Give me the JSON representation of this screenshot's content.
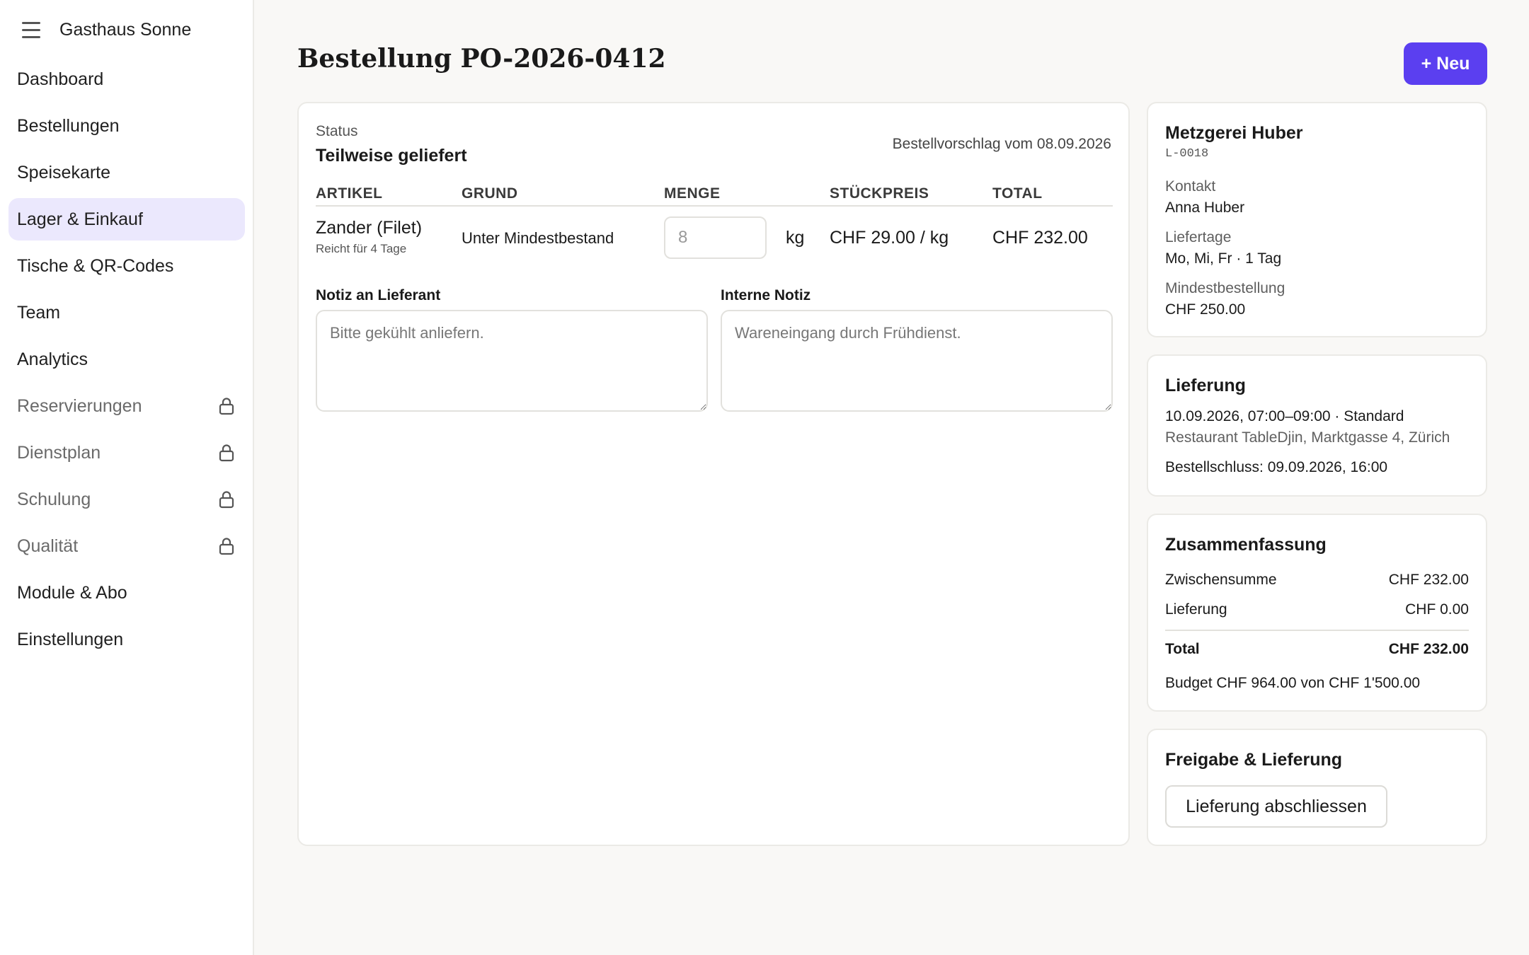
{
  "app": {
    "name": "Gasthaus Sonne"
  },
  "sidebar": {
    "items": [
      {
        "label": "Dashboard"
      },
      {
        "label": "Bestellungen"
      },
      {
        "label": "Speisekarte"
      },
      {
        "label": "Lager & Einkauf"
      },
      {
        "label": "Tische & QR-Codes"
      },
      {
        "label": "Team"
      },
      {
        "label": "Analytics"
      },
      {
        "label": "Reservierungen"
      },
      {
        "label": "Dienstplan"
      },
      {
        "label": "Schulung"
      },
      {
        "label": "Qualität"
      },
      {
        "label": "Module & Abo"
      },
      {
        "label": "Einstellungen"
      }
    ],
    "active": "Lager & Einkauf",
    "locked": [
      "Reservierungen",
      "Dienstplan",
      "Schulung",
      "Qualität"
    ]
  },
  "header": {
    "title": "Bestellung PO-2026-0412",
    "new_button": "+ Neu"
  },
  "order": {
    "status_label": "Status",
    "status_value": "Teilweise geliefert",
    "proposal_date": "Bestellvorschlag vom 08.09.2026",
    "columns": [
      "ARTIKEL",
      "GRUND",
      "MENGE",
      "STÜCKPREIS",
      "TOTAL"
    ],
    "rows": [
      {
        "name": "Zander (Filet)",
        "sub": "Reicht für 4 Tage",
        "reason": "Unter Mindestbestand",
        "quantity_placeholder": "8",
        "unit": "kg",
        "unit_price": "CHF 29.00 / kg",
        "total": "CHF 232.00"
      }
    ],
    "supplier_note_label": "Notiz an Lieferant",
    "supplier_note_placeholder": "Bitte gekühlt anliefern.",
    "internal_note_label": "Interne Notiz",
    "internal_note_placeholder": "Wareneingang durch Frühdienst."
  },
  "supplier": {
    "name": "Metzgerei Huber",
    "id": "L-0018",
    "contact_label": "Kontakt",
    "contact_value": "Anna Huber",
    "delivery_days_label": "Liefertage",
    "delivery_days_value": "Mo, Mi, Fr · 1 Tag",
    "min_order_label": "Mindestbestellung",
    "min_order_value": "CHF 250.00"
  },
  "delivery": {
    "title": "Lieferung",
    "window": "10.09.2026, 07:00–09:00 · Standard",
    "address": "Restaurant TableDjin, Marktgasse 4, Zürich",
    "cutoff": "Bestellschluss: 09.09.2026, 16:00"
  },
  "summary": {
    "title": "Zusammenfassung",
    "subtotal_label": "Zwischensumme",
    "subtotal_value": "CHF 232.00",
    "delivery_label": "Lieferung",
    "delivery_value": "CHF 0.00",
    "total_label": "Total",
    "total_value": "CHF 232.00",
    "budget": "Budget CHF 964.00 von CHF 1'500.00"
  },
  "approval": {
    "title": "Freigabe & Lieferung",
    "button": "Lieferung abschliessen"
  },
  "colors": {
    "accent": "#5b3ff0",
    "active_nav_bg": "#ebe8fd",
    "background": "#f9f8f6"
  }
}
